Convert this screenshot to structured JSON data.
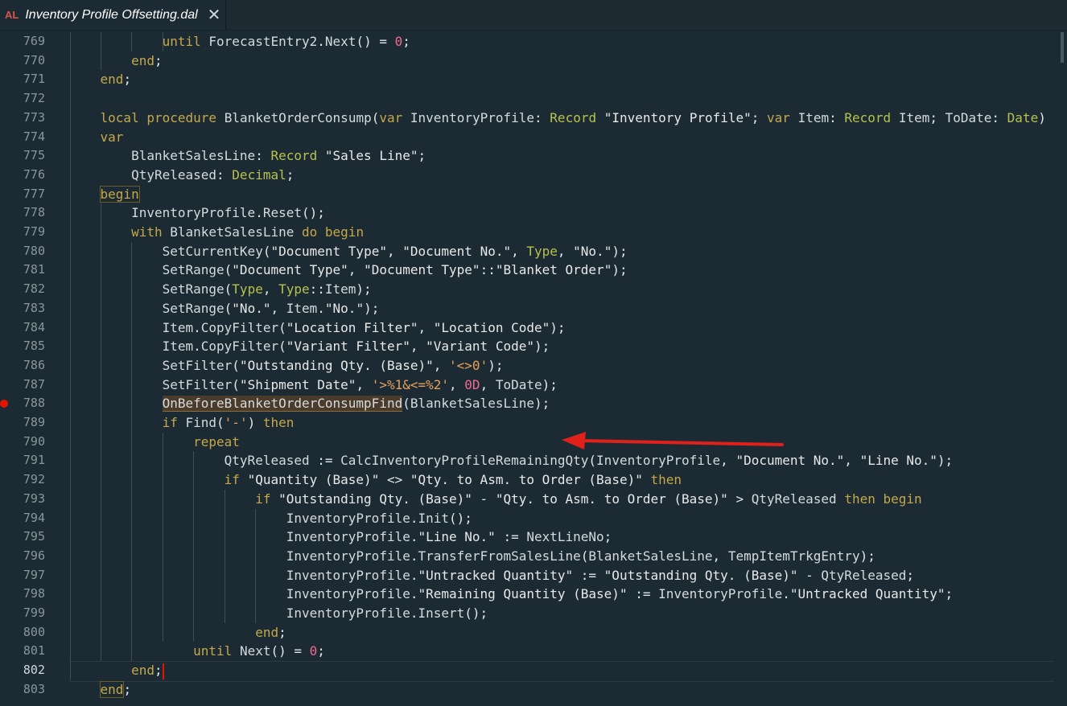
{
  "tab": {
    "lang_badge": "AL",
    "title": "Inventory Profile Offsetting.dal",
    "close_glyph": "✕"
  },
  "lines": [
    {
      "n": "769",
      "t": "            until ForecastEntry2.Next() = 0;"
    },
    {
      "n": "770",
      "t": "        end;"
    },
    {
      "n": "771",
      "t": "    end;"
    },
    {
      "n": "772",
      "t": ""
    },
    {
      "n": "773",
      "t": "    local procedure BlanketOrderConsump(var InventoryProfile: Record \"Inventory Profile\"; var Item: Record Item; ToDate: Date)"
    },
    {
      "n": "774",
      "t": "    var"
    },
    {
      "n": "775",
      "t": "        BlanketSalesLine: Record \"Sales Line\";"
    },
    {
      "n": "776",
      "t": "        QtyReleased: Decimal;"
    },
    {
      "n": "777",
      "t": "    begin"
    },
    {
      "n": "778",
      "t": "        InventoryProfile.Reset();"
    },
    {
      "n": "779",
      "t": "        with BlanketSalesLine do begin"
    },
    {
      "n": "780",
      "t": "            SetCurrentKey(\"Document Type\", \"Document No.\", Type, \"No.\");"
    },
    {
      "n": "781",
      "t": "            SetRange(\"Document Type\", \"Document Type\"::\"Blanket Order\");"
    },
    {
      "n": "782",
      "t": "            SetRange(Type, Type::Item);"
    },
    {
      "n": "783",
      "t": "            SetRange(\"No.\", Item.\"No.\");"
    },
    {
      "n": "784",
      "t": "            Item.CopyFilter(\"Location Filter\", \"Location Code\");"
    },
    {
      "n": "785",
      "t": "            Item.CopyFilter(\"Variant Filter\", \"Variant Code\");"
    },
    {
      "n": "786",
      "t": "            SetFilter(\"Outstanding Qty. (Base)\", '<>0');"
    },
    {
      "n": "787",
      "t": "            SetFilter(\"Shipment Date\", '>%1&<=%2', 0D, ToDate);"
    },
    {
      "n": "788",
      "t": "            OnBeforeBlanketOrderConsumpFind(BlanketSalesLine);"
    },
    {
      "n": "789",
      "t": "            if Find('-') then"
    },
    {
      "n": "790",
      "t": "                repeat"
    },
    {
      "n": "791",
      "t": "                    QtyReleased := CalcInventoryProfileRemainingQty(InventoryProfile, \"Document No.\", \"Line No.\");"
    },
    {
      "n": "792",
      "t": "                    if \"Quantity (Base)\" <> \"Qty. to Asm. to Order (Base)\" then"
    },
    {
      "n": "793",
      "t": "                        if \"Outstanding Qty. (Base)\" - \"Qty. to Asm. to Order (Base)\" > QtyReleased then begin"
    },
    {
      "n": "794",
      "t": "                            InventoryProfile.Init();"
    },
    {
      "n": "795",
      "t": "                            InventoryProfile.\"Line No.\" := NextLineNo;"
    },
    {
      "n": "796",
      "t": "                            InventoryProfile.TransferFromSalesLine(BlanketSalesLine, TempItemTrkgEntry);"
    },
    {
      "n": "797",
      "t": "                            InventoryProfile.\"Untracked Quantity\" := \"Outstanding Qty. (Base)\" - QtyReleased;"
    },
    {
      "n": "798",
      "t": "                            InventoryProfile.\"Remaining Quantity (Base)\" := InventoryProfile.\"Untracked Quantity\";"
    },
    {
      "n": "799",
      "t": "                            InventoryProfile.Insert();"
    },
    {
      "n": "800",
      "t": "                        end;"
    },
    {
      "n": "801",
      "t": "                until Next() = 0;"
    },
    {
      "n": "802",
      "t": "        end;"
    },
    {
      "n": "803",
      "t": "    end;"
    }
  ],
  "breakpoint_line": "788",
  "active_line": "802",
  "colors": {
    "background": "#1c2b33",
    "keyword": "#c5a84a",
    "type": "#b7c24d",
    "number": "#f26a8d",
    "breakpoint": "#e51400",
    "arrow": "#e0201a"
  },
  "icons": {
    "breakpoint": "breakpoint-dot-icon",
    "arrow": "red-arrow-annotation",
    "text_cursor": "i-beam-cursor-icon"
  }
}
